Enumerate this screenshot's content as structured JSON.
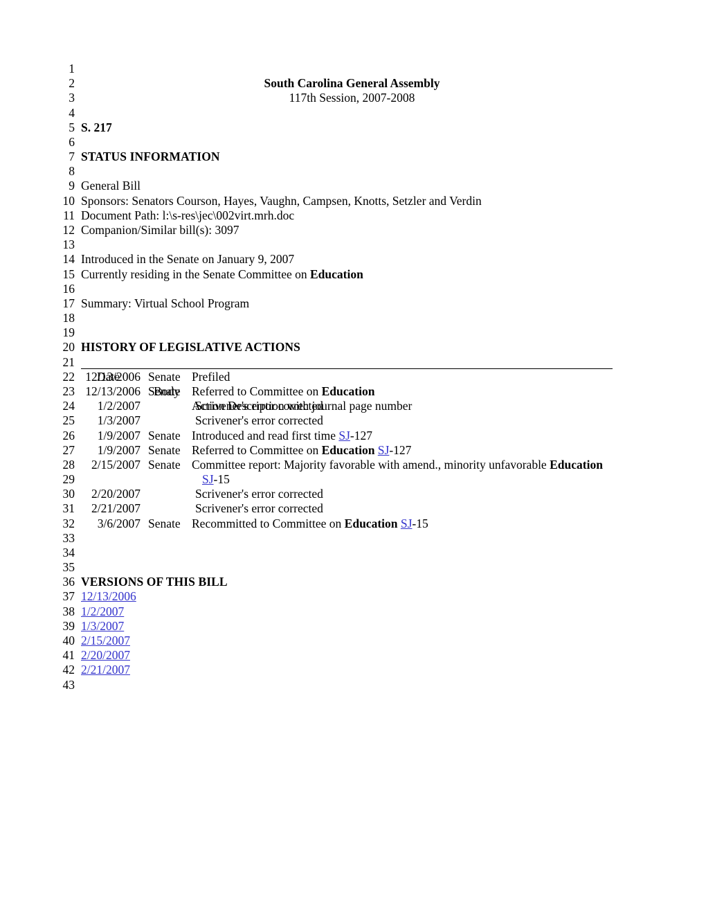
{
  "document": {
    "header_title": "South Carolina General Assembly",
    "header_session": "117th Session, 2007-2008",
    "bill_number": "S. 217"
  },
  "status_information": {
    "heading": "STATUS INFORMATION",
    "bill_type": "General Bill",
    "sponsors": "Sponsors: Senators Courson, Hayes, Vaughn, Campsen, Knotts, Setzler and Verdin",
    "document_path": "Document Path: l:\\s-res\\jec\\002virt.mrh.doc",
    "companion": "Companion/Similar bill(s): 3097",
    "introduced": "Introduced in the Senate on January 9, 2007",
    "residing_prefix": "Currently residing in the Senate Committee on ",
    "residing_committee": "Education",
    "summary": "Summary: Virtual School Program"
  },
  "history": {
    "heading": "HISTORY OF LEGISLATIVE ACTIONS",
    "columns": {
      "date": "Date",
      "body": "Body",
      "action": "Action Description with journal page number"
    },
    "rows": [
      {
        "line": "22",
        "date": "12/13/2006",
        "body": "Senate",
        "action_pre": "Prefiled",
        "bold": "",
        "action_post": "",
        "link": "",
        "link_post": ""
      },
      {
        "line": "23",
        "date": "12/13/2006",
        "body": "Senate",
        "action_pre": "Referred to Committee on ",
        "bold": "Education",
        "action_post": "",
        "link": "",
        "link_post": ""
      },
      {
        "line": "24",
        "date": "1/2/2007",
        "body": "",
        "action_pre": "Scrivener's error corrected",
        "bold": "",
        "action_post": "",
        "link": "",
        "link_post": ""
      },
      {
        "line": "25",
        "date": "1/3/2007",
        "body": "",
        "action_pre": "Scrivener's error corrected",
        "bold": "",
        "action_post": "",
        "link": "",
        "link_post": ""
      },
      {
        "line": "26",
        "date": "1/9/2007",
        "body": "Senate",
        "action_pre": "Introduced and read first time ",
        "bold": "",
        "action_post": "",
        "link": "SJ",
        "link_post": "-127"
      },
      {
        "line": "27",
        "date": "1/9/2007",
        "body": "Senate",
        "action_pre": "Referred to Committee on ",
        "bold": "Education",
        "action_post": " ",
        "link": "SJ",
        "link_post": "-127"
      },
      {
        "line": "28",
        "date": "2/15/2007",
        "body": "Senate",
        "action_pre": "Committee report: Majority favorable with amend., minority unfavorable ",
        "bold": "Education",
        "action_post": "",
        "link": "",
        "link_post": ""
      },
      {
        "line": "29",
        "date": "",
        "body": "",
        "action_pre": "",
        "bold": "",
        "action_post": "",
        "link": "SJ",
        "link_post": "-15"
      },
      {
        "line": "30",
        "date": "2/20/2007",
        "body": "",
        "action_pre": "Scrivener's error corrected",
        "bold": "",
        "action_post": "",
        "link": "",
        "link_post": ""
      },
      {
        "line": "31",
        "date": "2/21/2007",
        "body": "",
        "action_pre": "Scrivener's error corrected",
        "bold": "",
        "action_post": "",
        "link": "",
        "link_post": ""
      },
      {
        "line": "32",
        "date": "3/6/2007",
        "body": "Senate",
        "action_pre": "Recommitted to Committee on ",
        "bold": "Education",
        "action_post": " ",
        "link": "SJ",
        "link_post": "-15"
      }
    ]
  },
  "versions": {
    "heading": "VERSIONS OF THIS BILL",
    "items": [
      {
        "line": "37",
        "label": "12/13/2006"
      },
      {
        "line": "38",
        "label": "1/2/2007"
      },
      {
        "line": "39",
        "label": "1/3/2007"
      },
      {
        "line": "40",
        "label": "2/15/2007"
      },
      {
        "line": "41",
        "label": "2/20/2007"
      },
      {
        "line": "42",
        "label": "2/21/2007"
      }
    ]
  },
  "line_numbers": [
    "1",
    "2",
    "3",
    "4",
    "5",
    "6",
    "7",
    "8",
    "9",
    "10",
    "11",
    "12",
    "13",
    "14",
    "15",
    "16",
    "17",
    "18",
    "19",
    "20",
    "21",
    "22",
    "23",
    "24",
    "25",
    "26",
    "27",
    "28",
    "29",
    "30",
    "31",
    "32",
    "33",
    "34",
    "35",
    "36",
    "37",
    "38",
    "39",
    "40",
    "41",
    "42",
    "43"
  ],
  "colors": {
    "link": "#3333cc",
    "text": "#000000",
    "background": "#ffffff"
  }
}
